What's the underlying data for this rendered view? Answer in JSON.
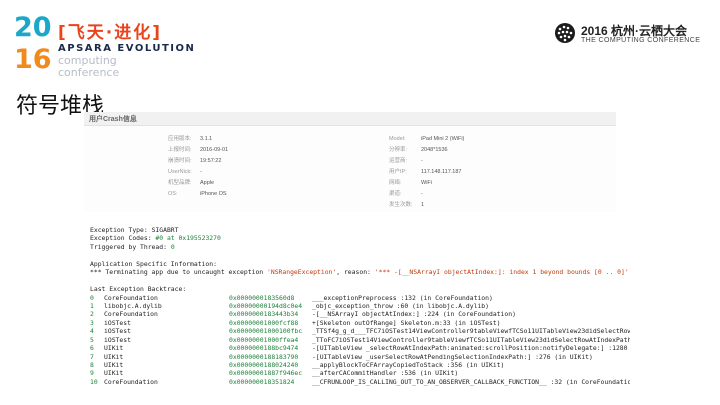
{
  "branding": {
    "digits_top": "20",
    "digits_bottom": "16",
    "cn_title": "[飞天·进化]",
    "apsara": "APSARA EVOLUTION",
    "sub_line1": "computing",
    "sub_line2": "conference",
    "right_line1": "2016 杭州·云栖大会",
    "right_line2": "THE COMPUTING CONFERENCE"
  },
  "slide_title": "符号堆栈",
  "crash_card": {
    "title": "用户Crash信息",
    "left": [
      {
        "k": "应用版本:",
        "v": "3.1.1"
      },
      {
        "k": "上报时间:",
        "v": "2016-09-01"
      },
      {
        "k": "崩溃时间:",
        "v": "19:57:22"
      },
      {
        "k": "UserNick:",
        "v": "-"
      },
      {
        "k": "机型品牌:",
        "v": "Apple"
      },
      {
        "k": "OS:",
        "v": "iPhone OS"
      }
    ],
    "right": [
      {
        "k": "Model:",
        "v": "iPad Mini 2 (WiFi)"
      },
      {
        "k": "分辨率:",
        "v": "2048*1536"
      },
      {
        "k": "运营商:",
        "v": "-"
      },
      {
        "k": "用户IP:",
        "v": "117.148.117.187"
      },
      {
        "k": "网络:",
        "v": "WiFi"
      },
      {
        "k": "渠道:",
        "v": "-"
      },
      {
        "k": "发生次数:",
        "v": "1"
      }
    ]
  },
  "log": {
    "exception_type_label": "Exception Type:  ",
    "exception_type": "SIGABRT",
    "exception_codes_label": "Exception Codes: ",
    "exception_codes": "#0 at 0x195523270",
    "triggered_label": "Triggered by Thread:  ",
    "triggered": "0",
    "app_info_header": "Application Specific Information:",
    "terminating_pre": "*** Terminating app due to uncaught exception ",
    "terminating_exc": "'NSRangeException'",
    "terminating_mid": ", reason: ",
    "terminating_reason": "'*** -[__NSArrayI objectAtIndex:]: index 1 beyond bounds [0 .. 0]'",
    "backtrace_header": "Last Exception Backtrace:",
    "backtrace": [
      {
        "i": "0",
        "mod": "CoreFoundation",
        "addr": "0x0000000183560d8",
        "sym": "___exceptionPreprocess :132 (in CoreFoundation)"
      },
      {
        "i": "1",
        "mod": "libobjc.A.dylib",
        "addr": "0x00000000194d8c0e4",
        "sym": "_objc_exception_throw :60 (in libobjc.A.dylib)"
      },
      {
        "i": "2",
        "mod": "CoreFoundation",
        "addr": "0x0000000183443b34",
        "sym": "-[__NSArrayI objectAtIndex:] :224 (in CoreFoundation)"
      },
      {
        "i": "3",
        "mod": "iOSTest",
        "addr": "0x00000001000fcf88",
        "sym": "+[Skeleton outOfRange] Skeleton.m:33 (in iOSTest)"
      },
      {
        "i": "4",
        "mod": "iOSTest",
        "addr": "0x00000001000100fbc",
        "sym": "_TTSf4g_g_d___TFC7iOSTest14ViewController9tableViewfTCSo11UITableView23didSelectRowAtI"
      },
      {
        "i": "5",
        "mod": "iOSTest",
        "addr": "0x00000001000ffea4",
        "sym": "_TToFC7iOSTest14ViewController9tableViewfTCSo11UITableView23didSelectRowAtIndexPathCSc"
      },
      {
        "i": "6",
        "mod": "UIKit",
        "addr": "0x0000000188bc9474",
        "sym": "-[UITableView _selectRowAtIndexPath:animated:scrollPosition:notifyDelegate:] :1280 (in"
      },
      {
        "i": "7",
        "mod": "UIKit",
        "addr": "0x0000000188183790",
        "sym": "-[UITableView _userSelectRowAtPendingSelectionIndexPath:] :276 (in UIKit)"
      },
      {
        "i": "8",
        "mod": "UIKit",
        "addr": "0x0000000188024240",
        "sym": "__applyBlockToCFArrayCopiedToStack :356 (in UIKit)"
      },
      {
        "i": "9",
        "mod": "UIKit",
        "addr": "0x00000001887f946ec",
        "sym": "__afterCACommitHandler :536 (in UIKit)"
      },
      {
        "i": "10",
        "mod": "CoreFoundation",
        "addr": "0x000000018351824",
        "sym": "__CFRUNLOOP_IS_CALLING_OUT_TO_AN_OBSERVER_CALLBACK_FUNCTION__ :32 (in CoreFoundatio"
      }
    ]
  }
}
